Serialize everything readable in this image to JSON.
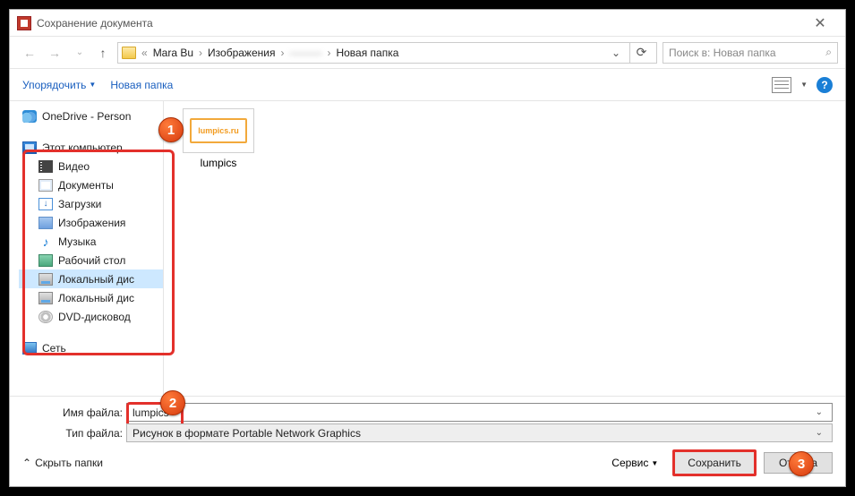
{
  "titlebar": {
    "title": "Сохранение документа",
    "close": "✕"
  },
  "nav": {
    "back": "←",
    "fwd": "→",
    "up": "↑"
  },
  "breadcrumb": {
    "lead": "«",
    "items": [
      "Mara Bu",
      "Изображения",
      "———",
      "Новая папка"
    ],
    "refresh": "⟳"
  },
  "search": {
    "placeholder": "Поиск в: Новая папка",
    "icon": "🔍"
  },
  "toolbar": {
    "organize": "Упорядочить",
    "newfolder": "Новая папка",
    "help": "?"
  },
  "sidebar": {
    "onedrive": "OneDrive - Person",
    "thispc": "Этот компьютер",
    "items": {
      "videos": "Видео",
      "documents": "Документы",
      "downloads": "Загрузки",
      "pictures": "Изображения",
      "music": "Музыка",
      "desktop": "Рабочий стол",
      "disk1": "Локальный дис",
      "disk2": "Локальный дис",
      "dvd": "DVD-дисковод"
    },
    "network": "Сеть"
  },
  "content": {
    "logo_text": "lumpics.ru",
    "filename": "lumpics"
  },
  "fields": {
    "name_label": "Имя файла:",
    "name_value": "lumpics",
    "type_label": "Тип файла:",
    "type_value": "Рисунок в формате Portable Network Graphics"
  },
  "footer": {
    "hide": "Скрыть папки",
    "service": "Сервис",
    "save": "Сохранить",
    "cancel": "Отмена"
  },
  "badges": {
    "one": "1",
    "two": "2",
    "three": "3"
  }
}
